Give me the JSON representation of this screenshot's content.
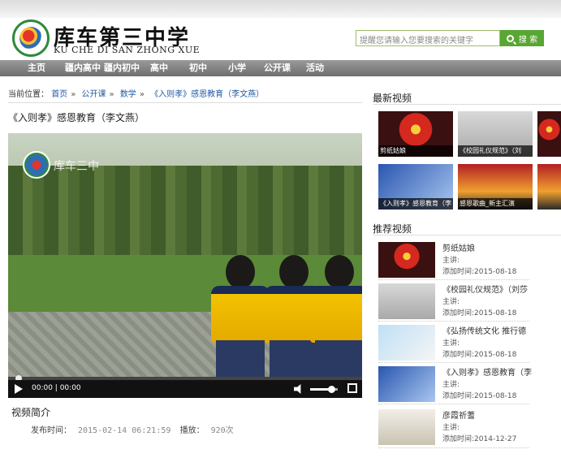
{
  "header": {
    "school_name_cn": "库车第三中学",
    "school_name_en": "KU CHE DI SAN ZHONG XUE",
    "search_placeholder": "提醒您请输入您要搜索的关键字",
    "search_button": "搜 索"
  },
  "nav": {
    "items": [
      "主页",
      "疆内高中",
      "疆内初中",
      "高中",
      "初中",
      "小学",
      "公开课",
      "活动"
    ]
  },
  "breadcrumb": {
    "prefix": "当前位置：",
    "items": [
      "首页",
      "公开课",
      "数学",
      "《入则孝》感恩教育（李文燕）"
    ],
    "sep": "»"
  },
  "video": {
    "title": "《入则孝》感恩教育（李文燕）",
    "watermark": "库车三中",
    "current_time": "00:00",
    "duration": "00:00",
    "progress": 0.02,
    "volume": 0.75
  },
  "info": {
    "heading": "视频简介",
    "publish_label": "发布时间：",
    "publish_time": "2015-02-14 06:21:59",
    "plays_label": "播放：",
    "plays": "920次"
  },
  "latest": {
    "heading": "最新视频",
    "items": [
      {
        "caption": "剪纸姑娘",
        "icon": "stage-red"
      },
      {
        "caption": "《校园礼仪规范》（刘",
        "icon": "presenter-gray"
      },
      {
        "caption": "《入则孝》感恩教育（李",
        "icon": "presenter-blue"
      },
      {
        "caption": "感恩歌曲_新主汇演",
        "icon": "stage-concert"
      }
    ]
  },
  "recommended": {
    "heading": "推荐视频",
    "speaker_label": "主讲:",
    "added_label": "添加时间:",
    "items": [
      {
        "title": "剪纸姑娘",
        "date": "2015-08-18"
      },
      {
        "title": "《校园礼仪规范》（刘莎",
        "date": "2015-08-18"
      },
      {
        "title": "《弘扬传统文化 推行德",
        "date": "2015-08-18"
      },
      {
        "title": "《入则孝》感恩教育（李",
        "date": "2015-08-18"
      },
      {
        "title": "彦霞祈蓍",
        "date": "2014-12-27"
      }
    ]
  },
  "colors": {
    "nav_bg": "#7f7f7f",
    "search_button": "#58a633",
    "link": "#1f5aa6"
  }
}
